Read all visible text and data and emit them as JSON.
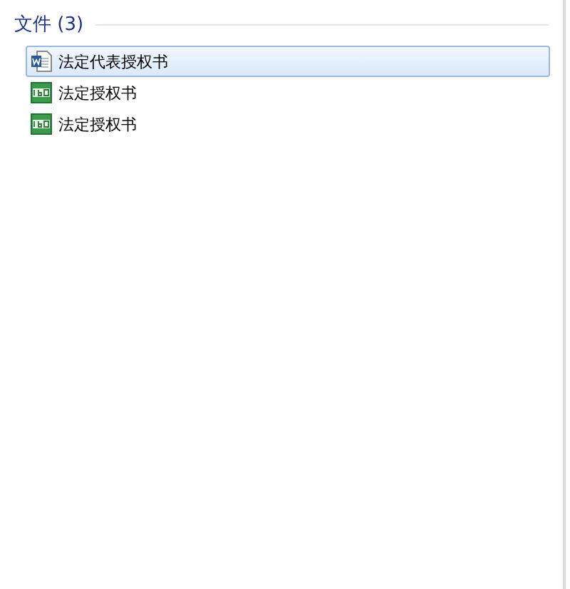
{
  "group": {
    "title": "文件 (3)"
  },
  "items": [
    {
      "label": "法定代表授权书",
      "kind": "word",
      "selected": true
    },
    {
      "label": "法定授权书",
      "kind": "image",
      "selected": false
    },
    {
      "label": "法定授权书",
      "kind": "image",
      "selected": false
    }
  ]
}
